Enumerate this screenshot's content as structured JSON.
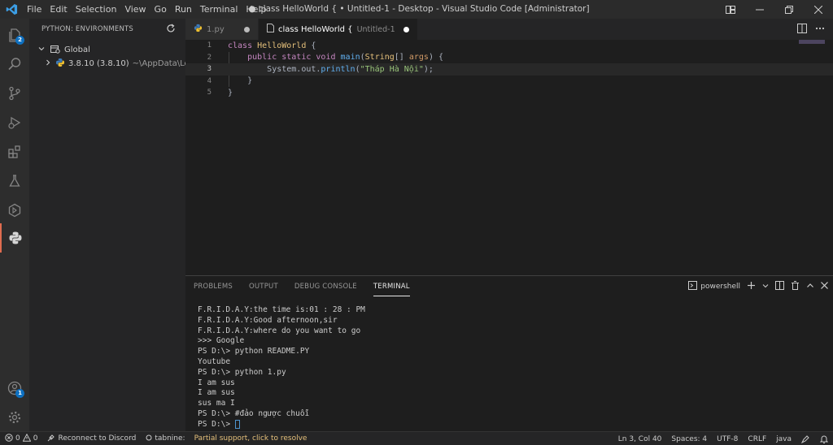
{
  "menu": [
    "File",
    "Edit",
    "Selection",
    "View",
    "Go",
    "Run",
    "Terminal",
    "Help"
  ],
  "window_title": "● class HelloWorld { • Untitled-1 - Desktop - Visual Studio Code [Administrator]",
  "activity_badges": {
    "explorer": "2",
    "accounts": "1"
  },
  "sidebar": {
    "title": "PYTHON: ENVIRONMENTS",
    "global_label": "Global",
    "env_name": "3.8.10 (3.8.10)",
    "env_path": "~\\AppData\\Loc..."
  },
  "tabs": [
    {
      "label": "1.py",
      "desc": ""
    },
    {
      "label": "class HelloWorld {",
      "desc": "Untitled-1"
    }
  ],
  "editor": {
    "line_numbers": [
      "1",
      "2",
      "3",
      "4",
      "5"
    ],
    "line1": {
      "kw": "class",
      "name": "HelloWorld",
      "rest": " {"
    },
    "line2": {
      "kw1": "public",
      "kw2": "static",
      "kw3": "void",
      "fn": "main",
      "p1": "(",
      "type": "String",
      "p2": "[] ",
      "arg": "args",
      "p3": ") {"
    },
    "line3": {
      "obj": "System.out.",
      "fn": "println",
      "p1": "(",
      "str": "\"Tháp Hà Nội\"",
      "p2": ");"
    },
    "line4": "}",
    "line5": "}"
  },
  "panel": {
    "tabs": [
      "PROBLEMS",
      "OUTPUT",
      "DEBUG CONSOLE",
      "TERMINAL"
    ],
    "shell": "powershell",
    "terminal_lines": [
      "F.R.I.D.A.Y:the time is:01 : 28 : PM",
      "F.R.I.D.A.Y:Good afternoon,sir",
      "F.R.I.D.A.Y:where do you want to go",
      ">>> Google",
      "PS D:\\> python README.PY",
      "Youtube",
      "PS D:\\> python 1.py",
      "I am sus",
      "I am sus",
      "sus ma I",
      "PS D:\\> #đảo ngược chuỗi",
      "PS D:\\> "
    ]
  },
  "statusbar": {
    "errors": "0",
    "warnings": "0",
    "discord": "Reconnect to Discord",
    "tabnine": "tabnine:",
    "partial": "Partial support, click to resolve",
    "position": "Ln 3, Col 40",
    "spaces": "Spaces: 4",
    "encoding": "UTF-8",
    "eol": "CRLF",
    "language": "java"
  },
  "colors": {
    "accent_active": "#e06c4f",
    "badge": "#0e70c0",
    "keyword": "#c586c0",
    "class": "#e5c07b",
    "function": "#61afef",
    "string": "#98c379"
  }
}
